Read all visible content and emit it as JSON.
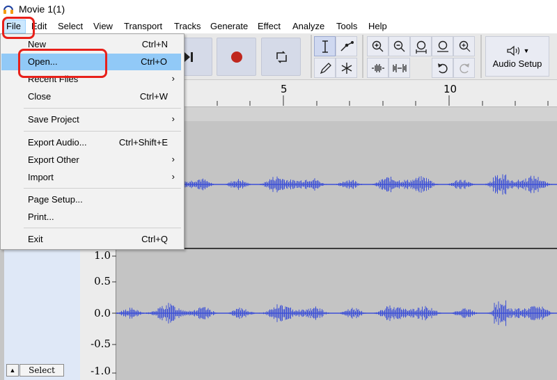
{
  "window": {
    "title": "Movie 1(1)"
  },
  "menubar": {
    "items": [
      "File",
      "Edit",
      "Select",
      "View",
      "Transport",
      "Tracks",
      "Generate",
      "Effect",
      "Analyze",
      "Tools",
      "Help"
    ]
  },
  "file_menu": {
    "items": [
      {
        "label": "New",
        "shortcut": "Ctrl+N",
        "submenu": false
      },
      {
        "label": "Open...",
        "shortcut": "Ctrl+O",
        "submenu": false,
        "highlighted": true
      },
      {
        "label": "Recent Files",
        "shortcut": "",
        "submenu": true
      },
      {
        "label": "Close",
        "shortcut": "Ctrl+W",
        "submenu": false
      },
      {
        "label": "Save Project",
        "shortcut": "",
        "submenu": true
      },
      {
        "label": "Export Audio...",
        "shortcut": "Ctrl+Shift+E",
        "submenu": false
      },
      {
        "label": "Export Other",
        "shortcut": "",
        "submenu": true
      },
      {
        "label": "Import",
        "shortcut": "",
        "submenu": true
      },
      {
        "label": "Page Setup...",
        "shortcut": "",
        "submenu": false
      },
      {
        "label": "Print...",
        "shortcut": "",
        "submenu": false
      },
      {
        "label": "Exit",
        "shortcut": "Ctrl+Q",
        "submenu": false
      }
    ]
  },
  "toolbar": {
    "audio_setup_label": "Audio Setup",
    "tools": [
      "selection-tool",
      "envelope-tool",
      "draw-tool",
      "multi-tool"
    ],
    "zoom": [
      "zoom-in",
      "zoom-out",
      "fit-selection",
      "fit-project",
      "zoom-toggle"
    ],
    "edit": [
      "trim-audio",
      "silence-audio",
      "undo",
      "redo"
    ]
  },
  "ruler": {
    "labels": [
      "5",
      "10"
    ]
  },
  "track": {
    "scale_labels": [
      "1.0",
      "0.5",
      "0.0",
      "-0.5",
      "-1.0"
    ],
    "select_label": "Select"
  },
  "colors": {
    "waveform": "#3c4fd6",
    "highlight": "#91c9f7",
    "annotation": "#e8201a"
  }
}
